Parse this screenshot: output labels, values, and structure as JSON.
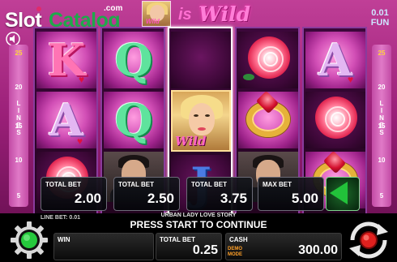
{
  "header": {
    "logo_slot": "Slot",
    "logo_catalog": "Catalog",
    "logo_com": ".com",
    "wild_banner_is": "is",
    "wild_banner_wild": "Wild",
    "wild_mini_label": "Wild",
    "coin_value": "0.01",
    "coin_unit": "FUN"
  },
  "lines": {
    "label": "LINES",
    "left_numbers": [
      "25",
      "20",
      "15",
      "10",
      "5"
    ],
    "right_numbers": [
      "25",
      "20",
      "15",
      "10",
      "5"
    ],
    "active": "25"
  },
  "reels": [
    {
      "symbols": [
        "K",
        "A",
        "rose"
      ]
    },
    {
      "symbols": [
        "Q",
        "Q",
        "man"
      ]
    },
    {
      "symbols": [
        "blank",
        "wild-lady",
        "J"
      ]
    },
    {
      "symbols": [
        "rose",
        "ring",
        "man"
      ]
    },
    {
      "symbols": [
        "A",
        "rose",
        "ring"
      ]
    }
  ],
  "wild_symbol_text": "Wild",
  "bet_options": [
    {
      "label": "TOTAL BET",
      "value": "2.00"
    },
    {
      "label": "TOTAL BET",
      "value": "2.50"
    },
    {
      "label": "TOTAL BET",
      "value": "3.75"
    },
    {
      "label": "MAX BET",
      "value": "5.00"
    }
  ],
  "bottom": {
    "line_bet": "LINE BET: 0.01",
    "game_name": "URBAN LADY LOVE STORY",
    "status": "PRESS START TO CONTINUE",
    "win_label": "WIN",
    "win_value": "",
    "total_bet_label": "TOTAL BET",
    "total_bet_value": "0.25",
    "cash_label": "CASH",
    "demo_mode": "DEMO MODE",
    "cash_value": "300.00"
  },
  "colors": {
    "accent_green": "#22c23a",
    "logo_green": "#1ea94b",
    "wild_pink": "#ff7ed8",
    "active_line_yellow": "#ffd23a"
  }
}
